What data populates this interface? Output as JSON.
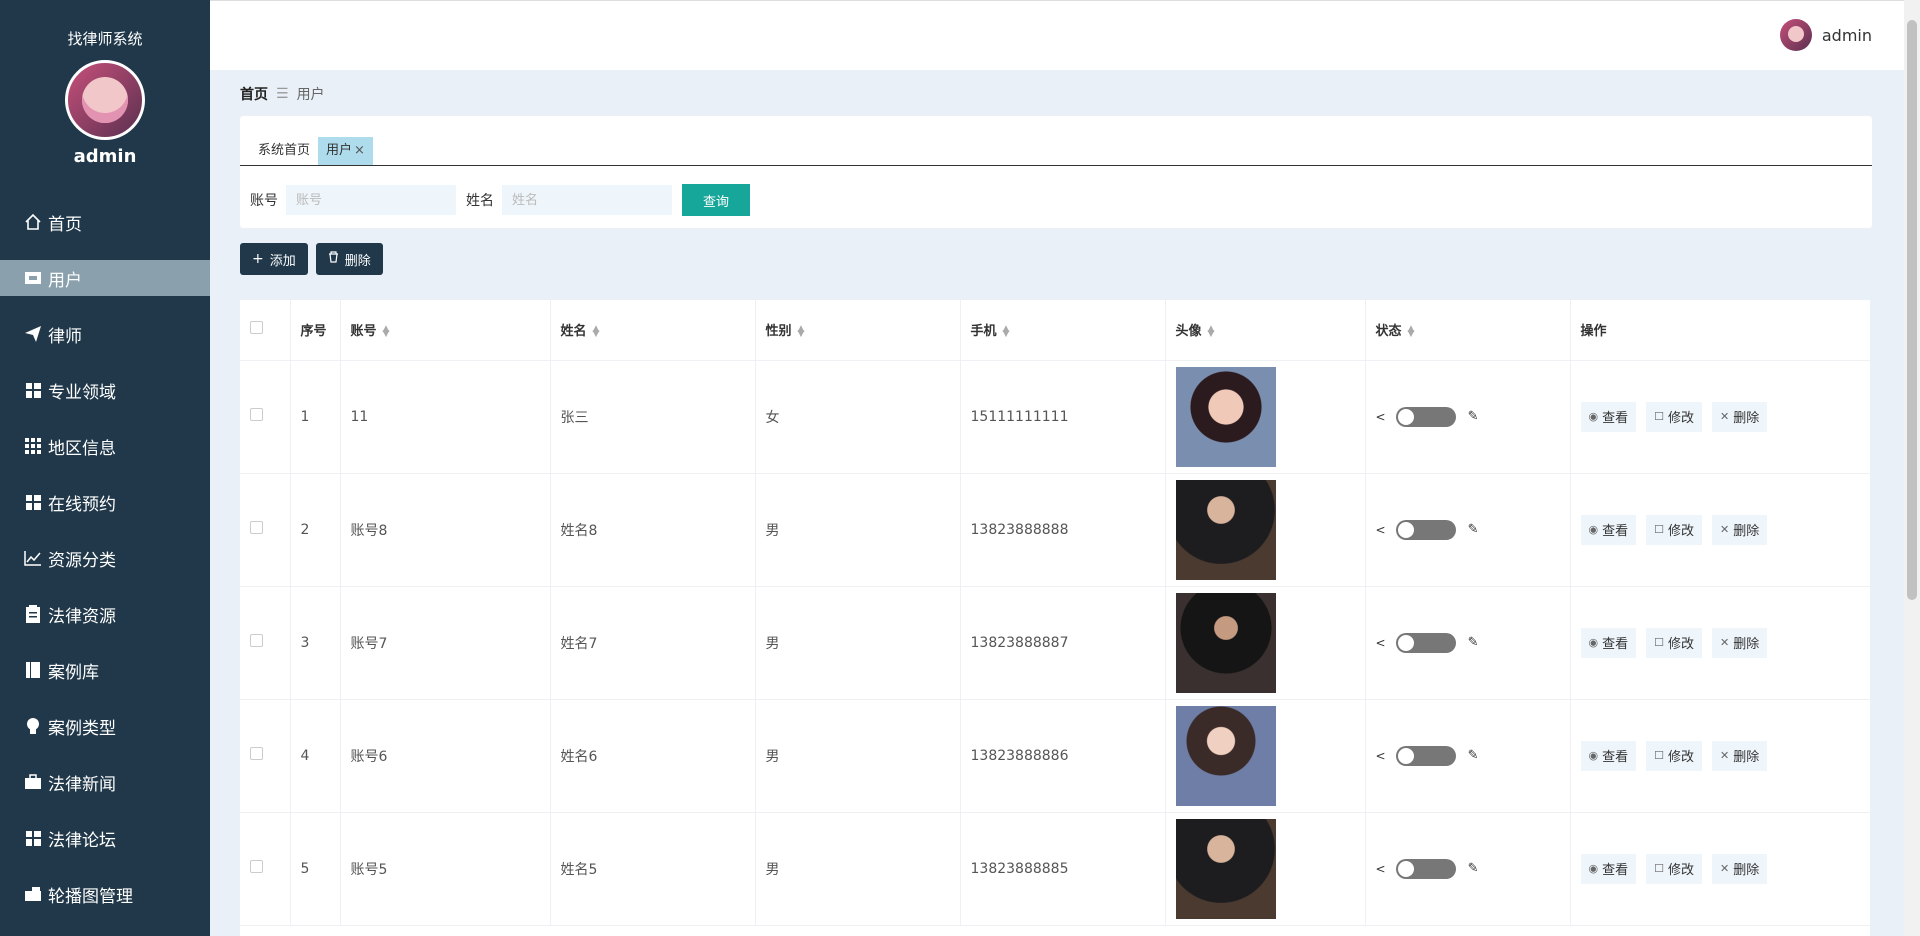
{
  "sidebar": {
    "system_title": "找律师系统",
    "username": "admin",
    "menu": [
      {
        "label": "首页",
        "icon": "home-icon"
      },
      {
        "label": "用户",
        "icon": "users-icon",
        "active": true
      },
      {
        "label": "律师",
        "icon": "paper-plane-icon"
      },
      {
        "label": "专业领域",
        "icon": "grid-icon"
      },
      {
        "label": "地区信息",
        "icon": "grid-icon"
      },
      {
        "label": "在线预约",
        "icon": "grid-icon"
      },
      {
        "label": "资源分类",
        "icon": "chart-line-icon"
      },
      {
        "label": "法律资源",
        "icon": "clipboard-icon"
      },
      {
        "label": "案例库",
        "icon": "book-icon"
      },
      {
        "label": "案例类型",
        "icon": "lightbulb-icon"
      },
      {
        "label": "法律新闻",
        "icon": "briefcase-icon"
      },
      {
        "label": "法律论坛",
        "icon": "grid-icon"
      },
      {
        "label": "轮播图管理",
        "icon": "suitcase-icon"
      }
    ]
  },
  "header": {
    "username": "admin"
  },
  "breadcrumb": {
    "home": "首页",
    "separator": "☰",
    "current": "用户"
  },
  "tabs": [
    {
      "label": "系统首页",
      "active": false
    },
    {
      "label": "用户",
      "active": true,
      "close": "×"
    }
  ],
  "search": {
    "account_label": "账号",
    "account_placeholder": "账号",
    "name_label": "姓名",
    "name_placeholder": "姓名",
    "query_button": "查询"
  },
  "toolbar": {
    "add_label": "添加",
    "delete_label": "删除"
  },
  "table": {
    "columns": [
      "序号",
      "账号",
      "姓名",
      "性别",
      "手机",
      "头像",
      "状态",
      "操作"
    ],
    "rows": [
      {
        "index": "1",
        "account": "11",
        "name": "张三",
        "gender": "女",
        "phone": "15111111111"
      },
      {
        "index": "2",
        "account": "账号8",
        "name": "姓名8",
        "gender": "男",
        "phone": "13823888888"
      },
      {
        "index": "3",
        "account": "账号7",
        "name": "姓名7",
        "gender": "男",
        "phone": "13823888887"
      },
      {
        "index": "4",
        "account": "账号6",
        "name": "姓名6",
        "gender": "男",
        "phone": "13823888886"
      },
      {
        "index": "5",
        "account": "账号5",
        "name": "姓名5",
        "gender": "男",
        "phone": "13823888885"
      }
    ],
    "row_actions": {
      "view": "查看",
      "edit": "修改",
      "delete": "删除"
    }
  },
  "colors": {
    "sidebar_bg": "#20384a",
    "active_menu": "#8aa0ad",
    "accent": "#17a69a",
    "tab_active": "#aedcec"
  }
}
